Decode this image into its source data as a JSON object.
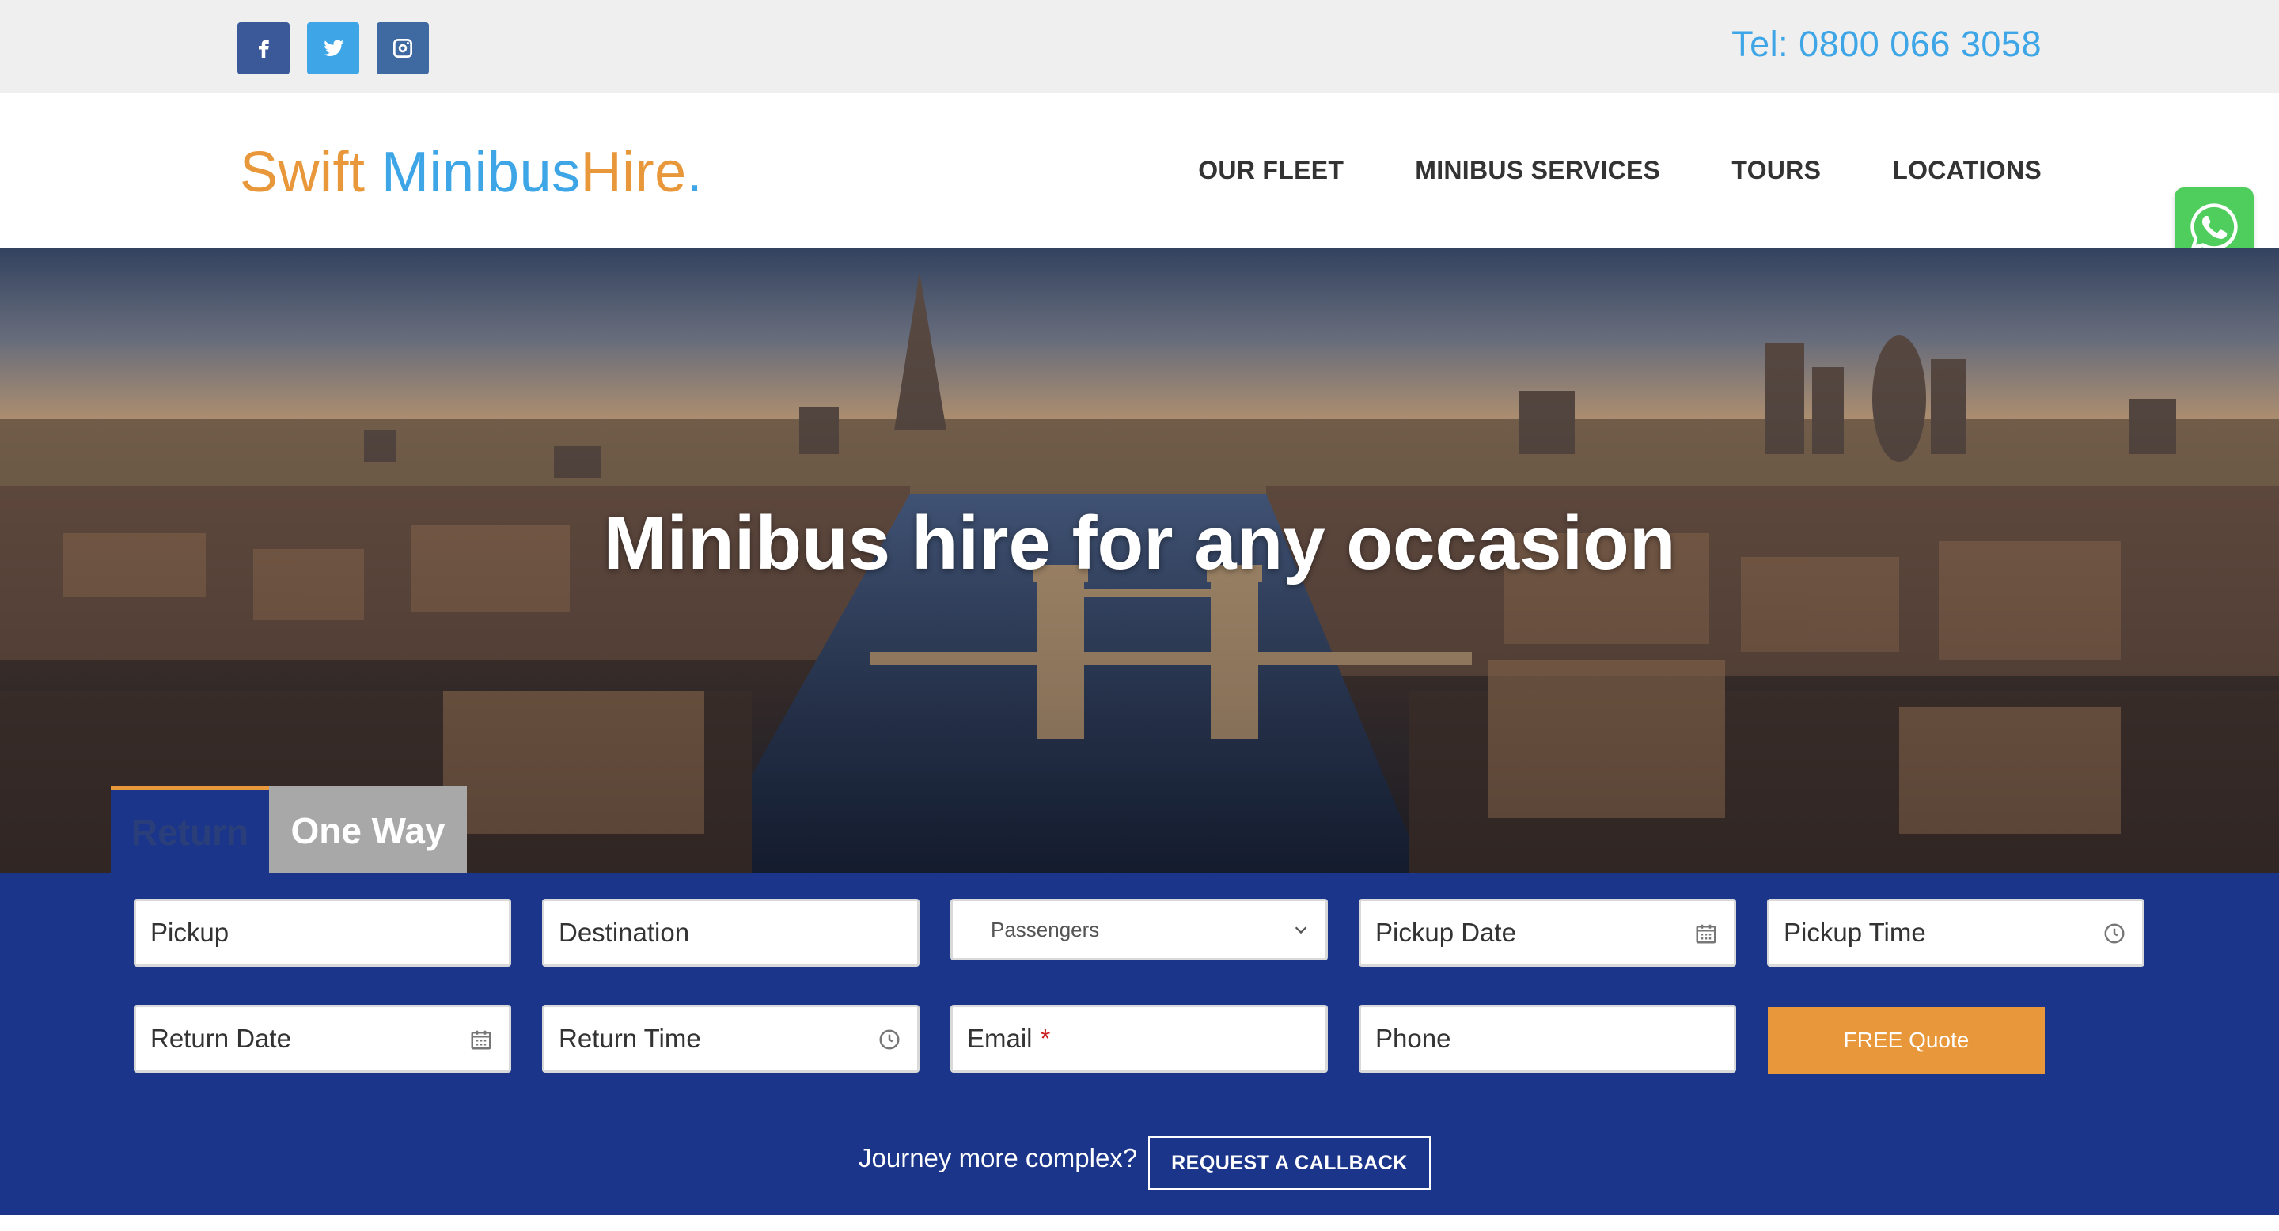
{
  "topbar": {
    "social": [
      "facebook-icon",
      "twitter-icon",
      "instagram-icon"
    ],
    "tel": "Tel: 0800 066 3058"
  },
  "header": {
    "logo": {
      "part1": "Swift",
      "part2": "Minibus",
      "part3": "Hire",
      "part4": "."
    },
    "nav": [
      "OUR FLEET",
      "MINIBUS SERVICES",
      "TOURS",
      "LOCATIONS"
    ]
  },
  "hero": {
    "title": "Minibus hire for any occasion"
  },
  "tabs": {
    "return": "Return",
    "oneway": "One Way"
  },
  "form": {
    "pickup": "Pickup",
    "destination": "Destination",
    "passengers": "Passengers",
    "pickup_date": "Pickup Date",
    "pickup_time": "Pickup Time",
    "return_date": "Return Date",
    "return_time": "Return Time",
    "email": "Email",
    "email_required": "*",
    "phone": "Phone",
    "quote_button": "FREE Quote",
    "complex_text": "Journey more complex?",
    "callback_button": "REQUEST A CALLBACK"
  },
  "colors": {
    "accent_orange": "#e8983a",
    "accent_blue": "#3ea6e6",
    "form_navy": "#1a358a",
    "whatsapp_green": "#4fce5d"
  }
}
